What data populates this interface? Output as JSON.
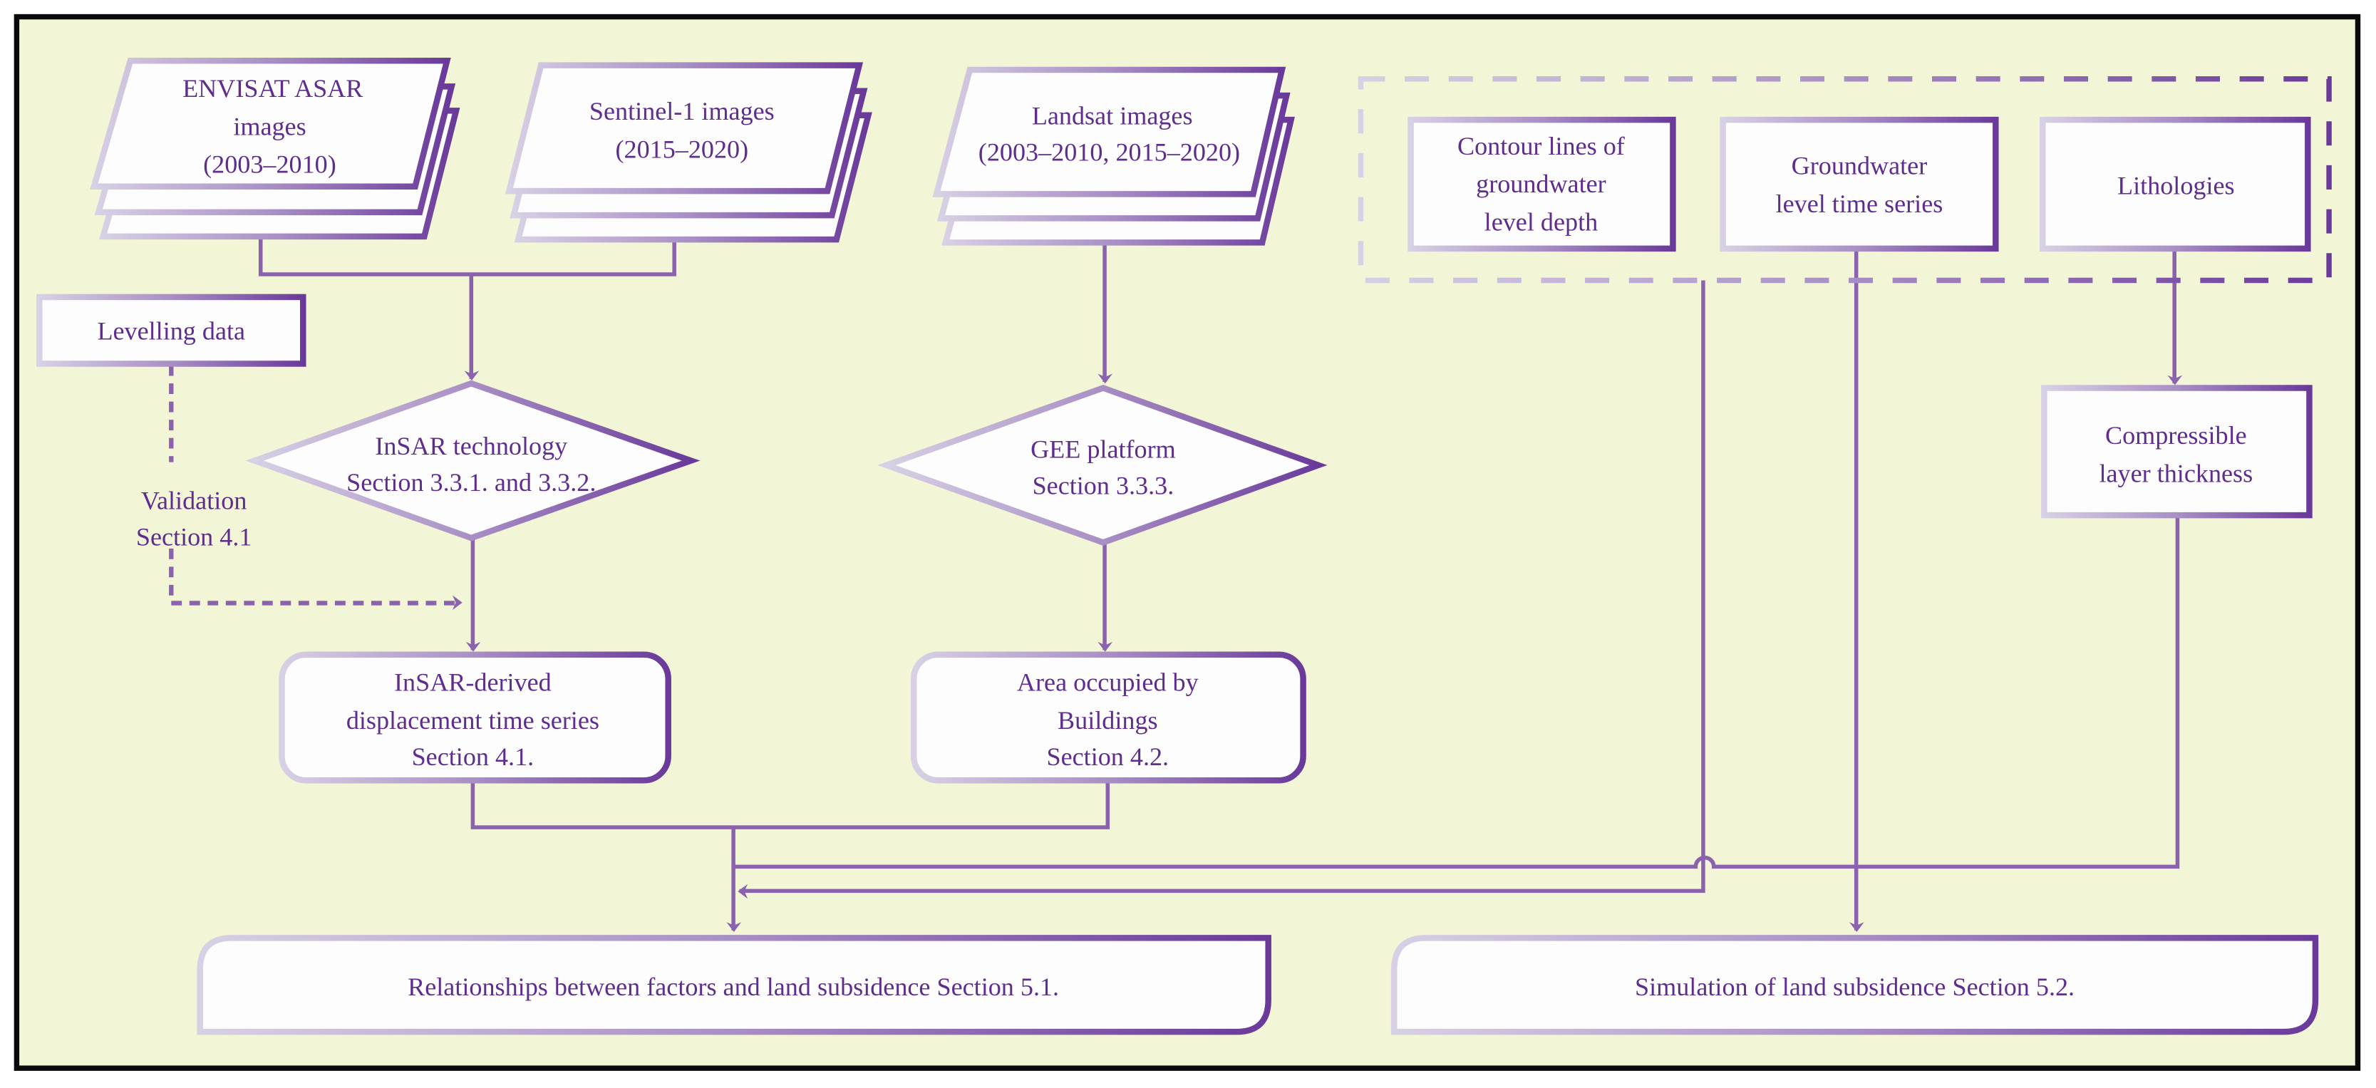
{
  "colors": {
    "background": "#F2F5D6",
    "line": "#8A62AE",
    "text": "#5E2D8E",
    "border_light": "#D8D0E4",
    "border_dark": "#6A3A9A",
    "frame": "#0A0A0A"
  },
  "inputs": {
    "envisat": [
      "ENVISAT ASAR",
      "images",
      "(2003–2010)"
    ],
    "sentinel": [
      "Sentinel-1 images",
      "(2015–2020)"
    ],
    "landsat": [
      "Landsat images",
      "(2003–2010, 2015–2020)"
    ],
    "levelling": "Levelling data"
  },
  "validation": [
    "Validation",
    "Section 4.1"
  ],
  "processes": {
    "insar": [
      "InSAR technology",
      "Section 3.3.1. and 3.3.2."
    ],
    "gee": [
      "GEE platform",
      "Section 3.3.3."
    ]
  },
  "products": {
    "displacement": [
      "InSAR-derived",
      "displacement time series",
      "Section 4.1."
    ],
    "buildings": [
      "Area occupied by",
      "Buildings",
      "Section 4.2."
    ]
  },
  "factors": {
    "contour": [
      "Contour lines of",
      "groundwater",
      "level depth"
    ],
    "groundwater": [
      "Groundwater",
      "level time series"
    ],
    "lithologies": "Lithologies",
    "compressible": [
      "Compressible",
      "layer thickness"
    ]
  },
  "outputs": {
    "relationships": "Relationships between factors and land subsidence Section 5.1.",
    "simulation": "Simulation of land subsidence Section 5.2."
  }
}
